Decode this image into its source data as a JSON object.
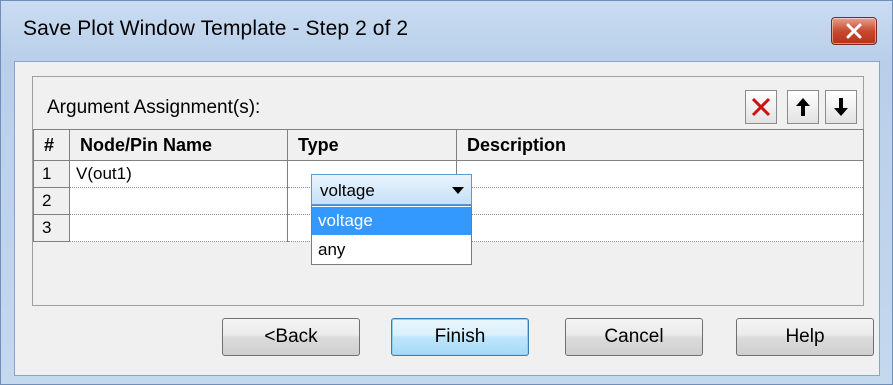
{
  "window": {
    "title": "Save Plot Window Template - Step 2 of 2",
    "close_icon": "close-x-icon"
  },
  "group": {
    "label": "Argument Assignment(s):",
    "toolbar": [
      {
        "name": "delete-icon",
        "color": "#d01010"
      },
      {
        "name": "arrow-up-icon",
        "color": "#000000"
      },
      {
        "name": "arrow-down-icon",
        "color": "#000000"
      }
    ]
  },
  "table": {
    "columns": [
      "#",
      "Node/Pin Name",
      "Type",
      "Description"
    ],
    "rows": [
      {
        "num": "1",
        "node": "V(out1)",
        "type": "voltage",
        "description": ""
      },
      {
        "num": "2",
        "node": "",
        "type": "",
        "description": ""
      },
      {
        "num": "3",
        "node": "",
        "type": "",
        "description": ""
      }
    ]
  },
  "type_combo": {
    "value": "voltage",
    "options": [
      "voltage",
      "any"
    ],
    "highlighted": "voltage"
  },
  "buttons": {
    "back": "<Back",
    "finish": "Finish",
    "cancel": "Cancel",
    "help": "Help"
  },
  "colors": {
    "selection": "#3399ff",
    "title_gradient": "#c9dcf2",
    "close_button": "#c84a30"
  }
}
